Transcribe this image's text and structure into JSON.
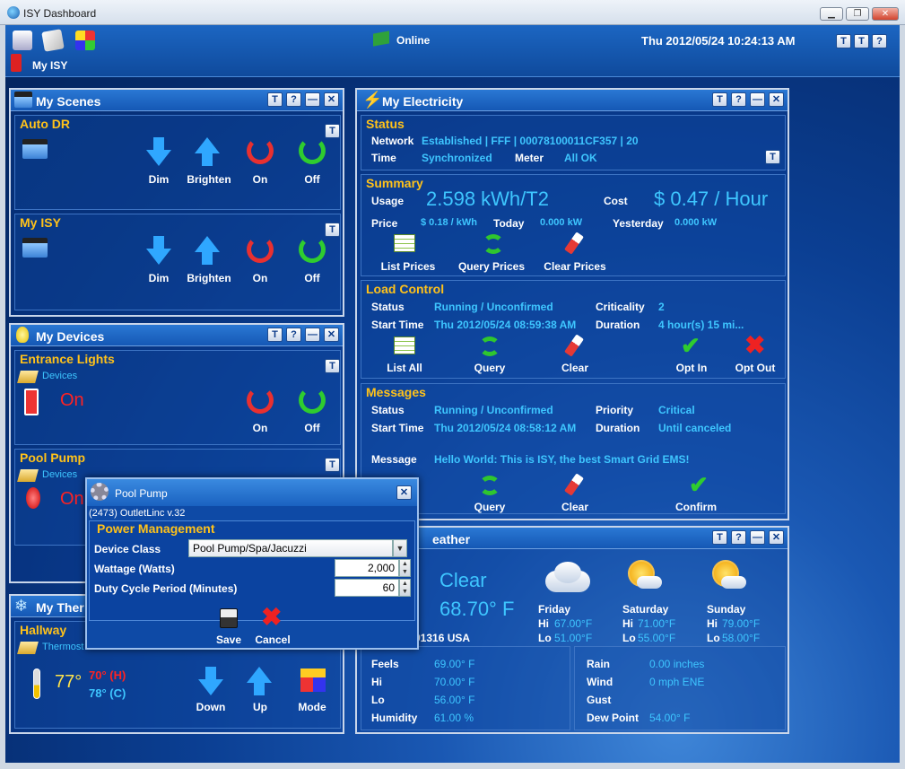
{
  "window": {
    "title": "ISY Dashboard"
  },
  "topbar": {
    "status": "Online",
    "datetime": "Thu 2012/05/24 10:24:13 AM",
    "my_isy": "My ISY"
  },
  "buttons": {
    "help": "?",
    "settings": "T",
    "minimize": "—",
    "close": "✕"
  },
  "scenes": {
    "title": "My Scenes",
    "groups": [
      {
        "name": "Auto DR",
        "actions": [
          "Dim",
          "Brighten",
          "On",
          "Off"
        ]
      },
      {
        "name": "My ISY",
        "actions": [
          "Dim",
          "Brighten",
          "On",
          "Off"
        ]
      }
    ]
  },
  "devices": {
    "title": "My Devices",
    "items": [
      {
        "name": "Entrance Lights",
        "link": "Devices",
        "state": "On",
        "actions": [
          "On",
          "Off"
        ]
      },
      {
        "name": "Pool Pump",
        "link": "Devices",
        "state": "On"
      }
    ]
  },
  "thermostat": {
    "title": "My Ther",
    "zone": "Hallway",
    "link": "Thermost",
    "temp": "77°",
    "heat": "70° (H)",
    "cool": "78° (C)",
    "actions": [
      "Down",
      "Up",
      "Mode"
    ]
  },
  "electricity": {
    "title": "My Electricity",
    "status": {
      "title": "Status",
      "network_label": "Network",
      "network_value": "Established | FFF | 00078100011CF357 | 20",
      "time_label": "Time",
      "time_value": "Synchronized",
      "meter_label": "Meter",
      "meter_value": "All OK"
    },
    "summary": {
      "title": "Summary",
      "usage_label": "Usage",
      "usage_value": "2.598 kWh/T2",
      "cost_label": "Cost",
      "cost_value": "$ 0.47 / Hour",
      "price_label": "Price",
      "price_value": "$ 0.18 / kWh",
      "today_label": "Today",
      "today_value": "0.000 kW",
      "yesterday_label": "Yesterday",
      "yesterday_value": "0.000 kW",
      "actions": [
        "List Prices",
        "Query Prices",
        "Clear Prices"
      ]
    },
    "load": {
      "title": "Load Control",
      "status_label": "Status",
      "status_value": "Running / Unconfirmed",
      "crit_label": "Criticality",
      "crit_value": "2",
      "start_label": "Start Time",
      "start_value": "Thu 2012/05/24 08:59:38 AM",
      "dur_label": "Duration",
      "dur_value": "4 hour(s) 15 mi...",
      "actions": [
        "List All",
        "Query",
        "Clear",
        "Opt In",
        "Opt Out"
      ]
    },
    "messages": {
      "title": "Messages",
      "status_label": "Status",
      "status_value": "Running / Unconfirmed",
      "prio_label": "Priority",
      "prio_value": "Critical",
      "start_label": "Start Time",
      "start_value": "Thu 2012/05/24 08:58:12 AM",
      "dur_label": "Duration",
      "dur_value": "Until canceled",
      "msg_label": "Message",
      "msg_value": "Hello World: This is ISY, the best Smart Grid EMS!",
      "actions": [
        "Query",
        "Clear",
        "Confirm"
      ]
    }
  },
  "weather": {
    "title": "eather",
    "condition": "Clear",
    "temp": "68.70° F",
    "location": "91316 USA",
    "forecast": [
      {
        "day": "Friday",
        "hi_label": "Hi",
        "hi": "67.00°F",
        "lo_label": "Lo",
        "lo": "51.00°F"
      },
      {
        "day": "Saturday",
        "hi_label": "Hi",
        "hi": "71.00°F",
        "lo_label": "Lo",
        "lo": "55.00°F"
      },
      {
        "day": "Sunday",
        "hi_label": "Hi",
        "hi": "79.00°F",
        "lo_label": "Lo",
        "lo": "58.00°F"
      }
    ],
    "left": [
      {
        "label": "Feels",
        "value": "69.00° F"
      },
      {
        "label": "Hi",
        "value": "70.00° F"
      },
      {
        "label": "Lo",
        "value": "56.00° F"
      },
      {
        "label": "Humidity",
        "value": "61.00 %"
      }
    ],
    "right": [
      {
        "label": "Rain",
        "value": "0.00 inches"
      },
      {
        "label": "Wind",
        "value": "0 mph ENE"
      },
      {
        "label": "Gust",
        "value": ""
      },
      {
        "label": "Dew Point",
        "value": "54.00° F"
      }
    ]
  },
  "dialog": {
    "title": "Pool Pump",
    "subtitle": "(2473) OutletLinc v.32",
    "section": "Power Management",
    "class_label": "Device Class",
    "class_value": "Pool Pump/Spa/Jacuzzi",
    "watt_label": "Wattage (Watts)",
    "watt_value": "2,000",
    "duty_label": "Duty Cycle Period (Minutes)",
    "duty_value": "60",
    "save": "Save",
    "cancel": "Cancel"
  }
}
